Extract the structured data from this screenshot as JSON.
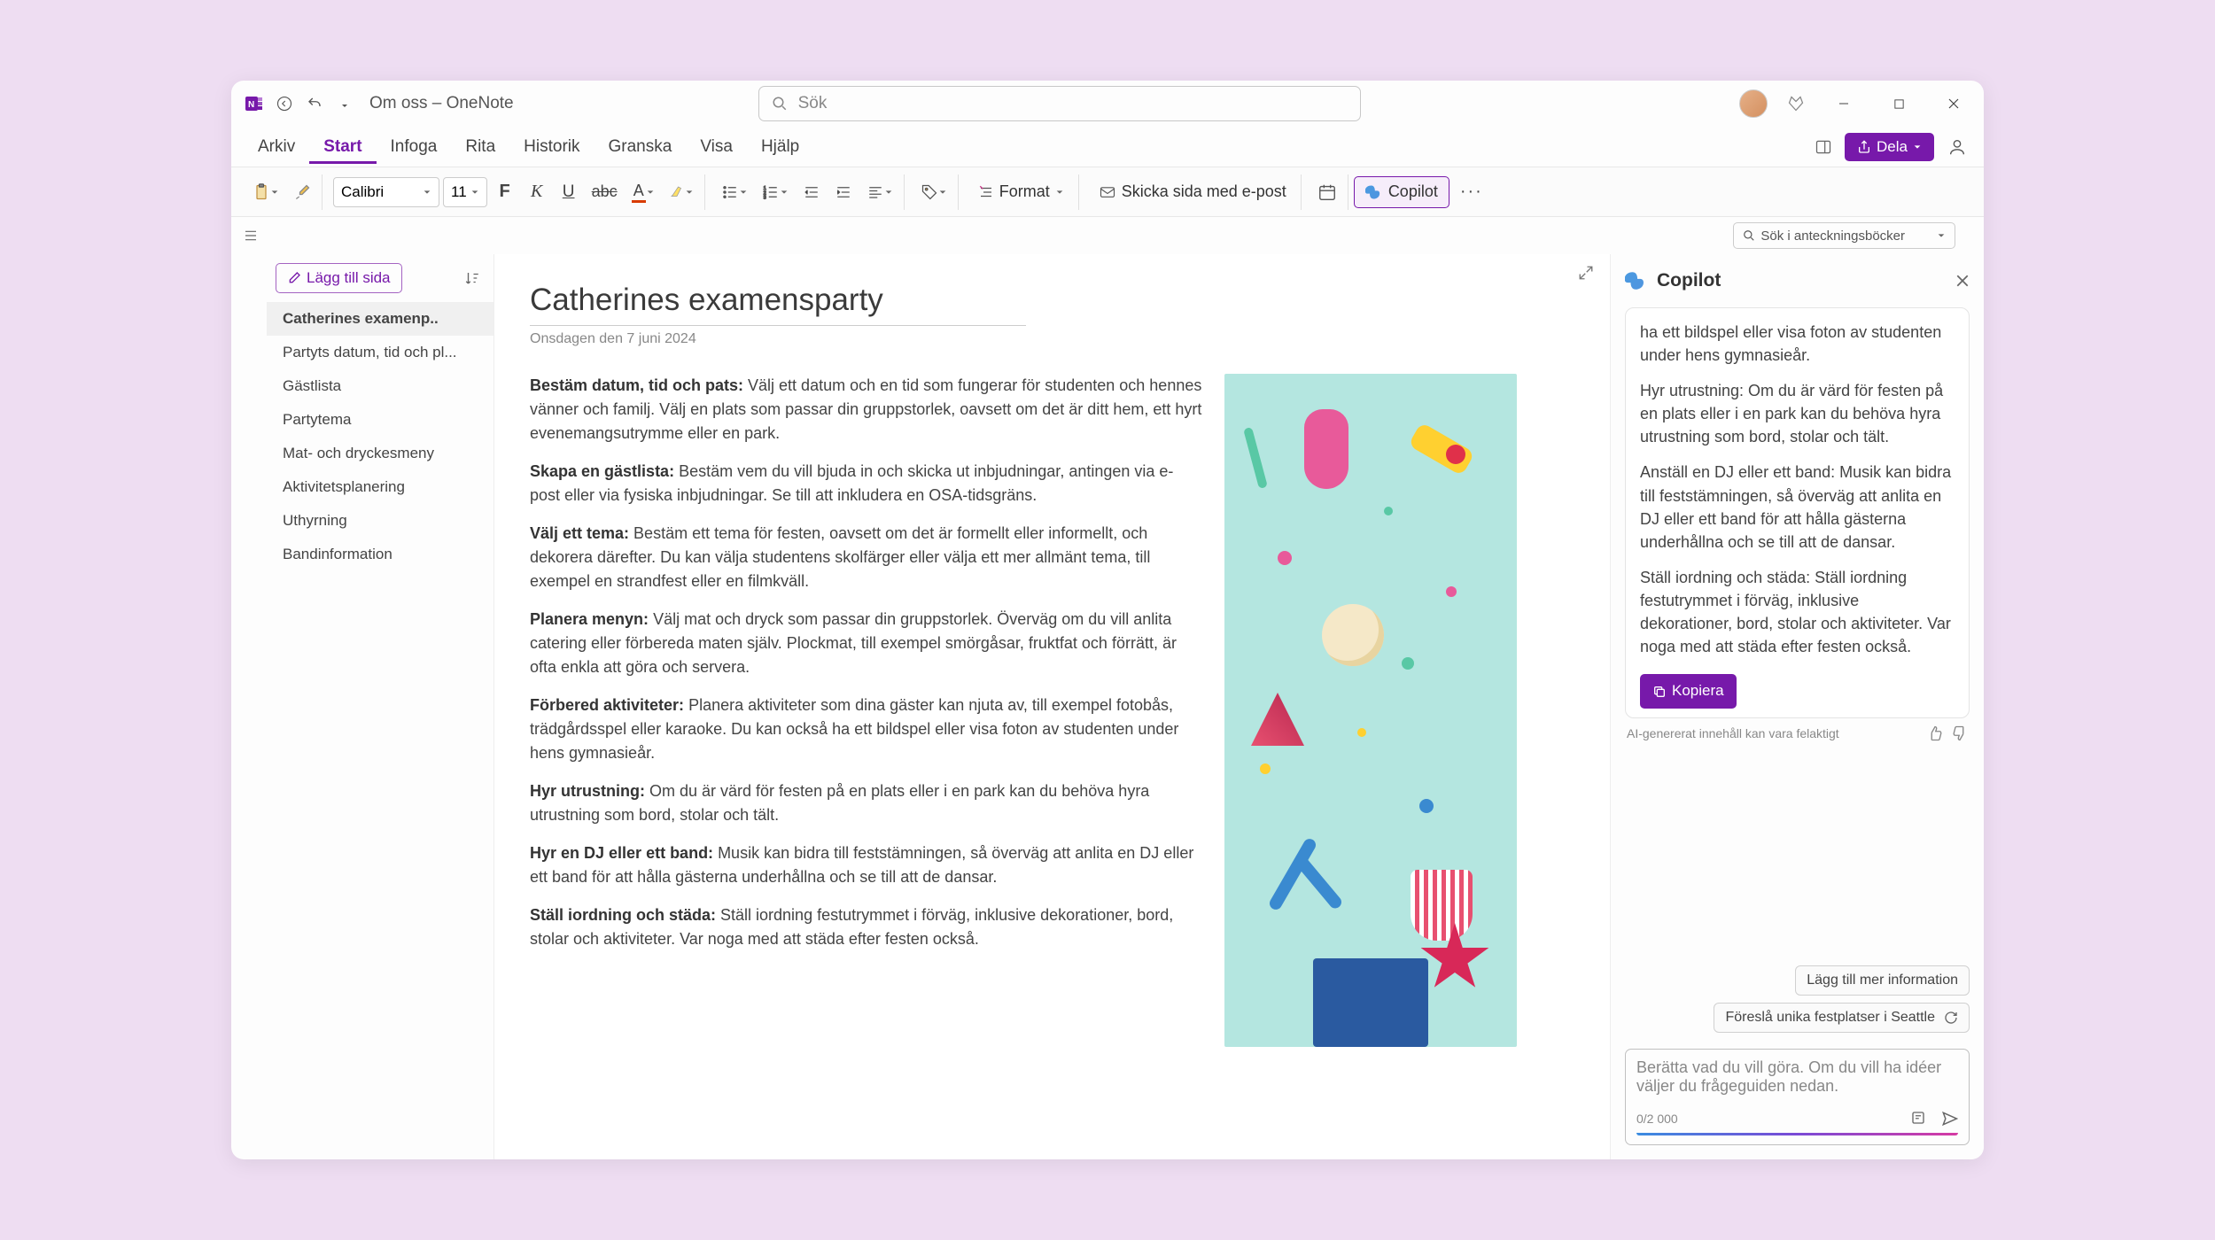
{
  "window": {
    "title": "Om oss – OneNote",
    "search_placeholder": "Sök"
  },
  "menu": {
    "items": [
      "Arkiv",
      "Start",
      "Infoga",
      "Rita",
      "Historik",
      "Granska",
      "Visa",
      "Hjälp"
    ],
    "active_index": 1,
    "share_label": "Dela"
  },
  "ribbon": {
    "font": "Calibri",
    "size": "11",
    "format_label": "Format",
    "email_label": "Skicka sida med e-post",
    "copilot_label": "Copilot"
  },
  "subbar": {
    "notebook_search": "Sök i anteckningsböcker"
  },
  "sidebar": {
    "add_page_label": "Lägg till sida",
    "pages": [
      "Catherines examenp..",
      "Partyts datum, tid och pl...",
      "Gästlista",
      "Partytema",
      "Mat- och dryckesmeny",
      "Aktivitetsplanering",
      "Uthyrning",
      "Bandinformation"
    ],
    "active_index": 0
  },
  "note": {
    "title": "Catherines examensparty",
    "date": "Onsdagen den 7 juni 2024",
    "paragraphs": [
      {
        "b": "Bestäm datum, tid och pats:",
        "t": " Välj ett datum och en tid som fungerar för studenten och hennes vänner och familj. Välj en plats som passar din gruppstorlek, oavsett om det är ditt hem, ett hyrt evenemangsutrymme eller en park."
      },
      {
        "b": "Skapa en gästlista:",
        "t": " Bestäm vem du vill bjuda in och skicka ut inbjudningar, antingen via e-post eller via fysiska inbjudningar. Se till att inkludera en OSA-tidsgräns."
      },
      {
        "b": "Välj ett tema:",
        "t": " Bestäm ett tema för festen, oavsett om det är formellt eller informellt, och dekorera därefter. Du kan välja studentens skolfärger eller välja ett mer allmänt tema, till exempel en strandfest eller en filmkväll."
      },
      {
        "b": "Planera menyn:",
        "t": " Välj mat och dryck som passar din gruppstorlek. Överväg om du vill anlita catering eller förbereda maten själv. Plockmat, till exempel smörgåsar, fruktfat och förrätt, är ofta enkla att göra och servera."
      },
      {
        "b": "Förbered aktiviteter:",
        "t": " Planera aktiviteter som dina gäster kan njuta av, till exempel fotobås, trädgårdsspel eller karaoke. Du kan också ha ett bildspel eller visa foton av studenten under hens gymnasieår."
      },
      {
        "b": "Hyr utrustning:",
        "t": " Om du är värd för festen på en plats eller i en park kan du behöva hyra utrustning som bord, stolar och tält."
      },
      {
        "b": "Hyr en DJ eller ett band:",
        "t": " Musik kan bidra till feststämningen, så överväg att anlita en DJ eller ett band för att hålla gästerna underhållna och se till att de dansar."
      },
      {
        "b": "Ställ iordning och städa:",
        "t": " Ställ iordning festutrymmet i förväg, inklusive dekorationer, bord, stolar och aktiviteter. Var noga med att städa efter festen också."
      }
    ]
  },
  "copilot": {
    "title": "Copilot",
    "messages": [
      "ha ett bildspel eller visa foton av studenten under hens gymnasieår.",
      "Hyr utrustning: Om du är värd för festen på en plats eller i en park kan du behöva hyra utrustning som bord, stolar och tält.",
      "Anställ en DJ eller ett band: Musik kan bidra till feststämningen, så överväg att anlita en DJ eller ett band för att hålla gästerna underhållna och se till att de dansar.",
      "Ställ iordning och städa: Ställ iordning festutrymmet i förväg, inklusive dekorationer, bord, stolar och aktiviteter. Var noga med att städa efter festen också."
    ],
    "copy_label": "Kopiera",
    "disclaimer": "AI-genererat innehåll kan vara felaktigt",
    "suggestions": [
      "Lägg till mer information",
      "Föreslå unika festplatser i Seattle"
    ],
    "input_placeholder": "Berätta vad du vill göra. Om du vill ha idéer väljer du frågeguiden nedan.",
    "counter": "0/2 000"
  }
}
